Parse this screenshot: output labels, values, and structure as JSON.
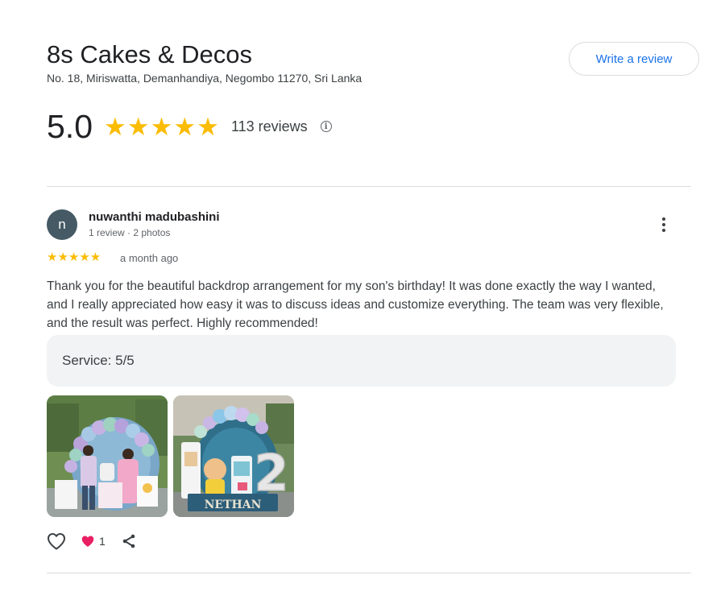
{
  "business": {
    "name": "8s Cakes & Decos",
    "address": "No. 18, Miriswatta, Demanhandiya, Negombo 11270, Sri Lanka",
    "write_review_label": "Write a review",
    "rating": "5.0",
    "stars": "★★★★★",
    "review_count": "113 reviews",
    "info_symbol": "i"
  },
  "review": {
    "avatar_letter": "n",
    "reviewer_name": "nuwanthi madubashini",
    "reviewer_meta": "1 review · 2 photos",
    "stars": "★★★★★",
    "time": "a month ago",
    "text": "Thank you for the beautiful backdrop arrangement for my son's birthday! It was done exactly the way I wanted, and I really appreciated how easy it was to discuss ideas and customize everything. The team was very flexible, and the result was perfect. Highly recommended!",
    "attribute": "Service: 5/5",
    "photos": [
      "photo-1",
      "photo-2"
    ],
    "photo2_banner": "NETHAN",
    "photo2_number": "2",
    "like_count": "1"
  },
  "icons": {
    "like": "heart-outline-icon",
    "liked": "heart-filled-icon",
    "share": "share-icon",
    "more": "more-vert-icon",
    "info": "info-icon"
  },
  "colors": {
    "star": "#fbbc04",
    "accent": "#1a73e8",
    "avatar_bg": "#455a64",
    "heart": "#e91e63",
    "attr_bg": "#f1f3f4"
  }
}
